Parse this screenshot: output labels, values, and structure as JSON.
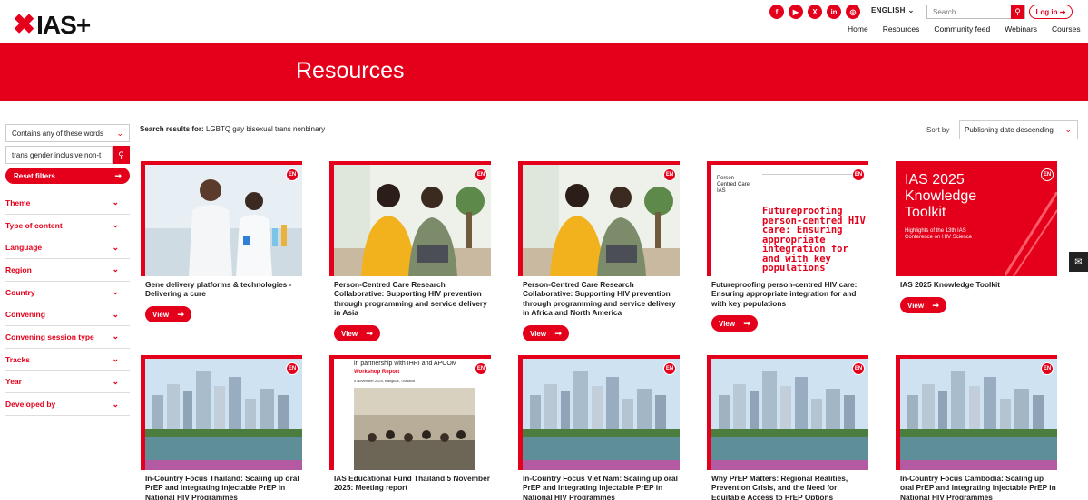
{
  "header": {
    "logo": "IAS+",
    "socials": [
      {
        "name": "facebook-icon",
        "glyph": "f"
      },
      {
        "name": "youtube-icon",
        "glyph": "▶"
      },
      {
        "name": "x-icon",
        "glyph": "X"
      },
      {
        "name": "linkedin-icon",
        "glyph": "in"
      },
      {
        "name": "instagram-icon",
        "glyph": "◎"
      }
    ],
    "language": "ENGLISH",
    "search_placeholder": "Search",
    "login_label": "Log in",
    "nav": [
      "Home",
      "Resources",
      "Community feed",
      "Webinars",
      "Courses"
    ]
  },
  "banner": {
    "title": "Resources"
  },
  "sidebar": {
    "match_mode": "Contains any of these words",
    "keyword_value": "trans gender inclusive non-t",
    "reset_label": "Reset filters",
    "filters": [
      "Theme",
      "Type of content",
      "Language",
      "Region",
      "Country",
      "Convening",
      "Convening session type",
      "Tracks",
      "Year",
      "Developed by"
    ]
  },
  "results": {
    "label": "Search results for:",
    "query": "LGBTQ gay bisexual trans nonbinary",
    "sort_label": "Sort by",
    "sort_value": "Publishing date descending"
  },
  "cards": [
    {
      "badge": "EN",
      "title": "Gene delivery platforms & technologies - Delivering a cure",
      "view": "View",
      "image": "lab"
    },
    {
      "badge": "EN",
      "title": "Person-Centred Care Research Collaborative: Supporting HIV prevention through programming and service delivery in Asia",
      "view": "View",
      "image": "couple"
    },
    {
      "badge": "EN",
      "title": "Person-Centred Care Research Collaborative: Supporting HIV prevention through programming and service delivery in Africa and North America",
      "view": "View",
      "image": "couple"
    },
    {
      "badge": "EN",
      "title": "Futureproofing person-centred HIV care: Ensuring appropriate integration for and with key populations",
      "view": "View",
      "image": "whiteposter",
      "poster": {
        "side": "Person-Centred Care IAS",
        "headline": "Futureproofing person-centred HIV care: Ensuring appropriate integration for and with key populations"
      }
    },
    {
      "badge": "EN",
      "title": "IAS 2025 Knowledge Toolkit",
      "view": "View",
      "image": "redposter",
      "poster": {
        "headline": "IAS 2025 Knowledge Toolkit",
        "sub": "Highlights of the 13th IAS Conference on HIV Science"
      }
    },
    {
      "badge": "EN",
      "title": "In-Country Focus Thailand: Scaling up oral PrEP and integrating injectable PrEP in National HIV Programmes",
      "image": "city"
    },
    {
      "badge": "EN",
      "title": "IAS Educational Fund Thailand 5 November 2025: Meeting report",
      "image": "workshop",
      "poster": {
        "top": "in partnership with IHRI and APCOM",
        "label": "Workshop Report",
        "date": "5 November 2025, Bangkok, Thailand"
      }
    },
    {
      "badge": "EN",
      "title": "In-Country Focus Viet Nam: Scaling up oral PrEP and integrating injectable PrEP in National HIV Programmes",
      "image": "city"
    },
    {
      "badge": "EN",
      "title": "Why PrEP Matters: Regional Realities, Prevention Crisis, and the Need for Equitable Access to PrEP Options",
      "image": "city"
    },
    {
      "badge": "EN",
      "title": "In-Country Focus Cambodia: Scaling up oral PrEP and integrating injectable PrEP in National HIV Programmes",
      "image": "city"
    }
  ],
  "colors": {
    "brand": "#e4001b"
  }
}
